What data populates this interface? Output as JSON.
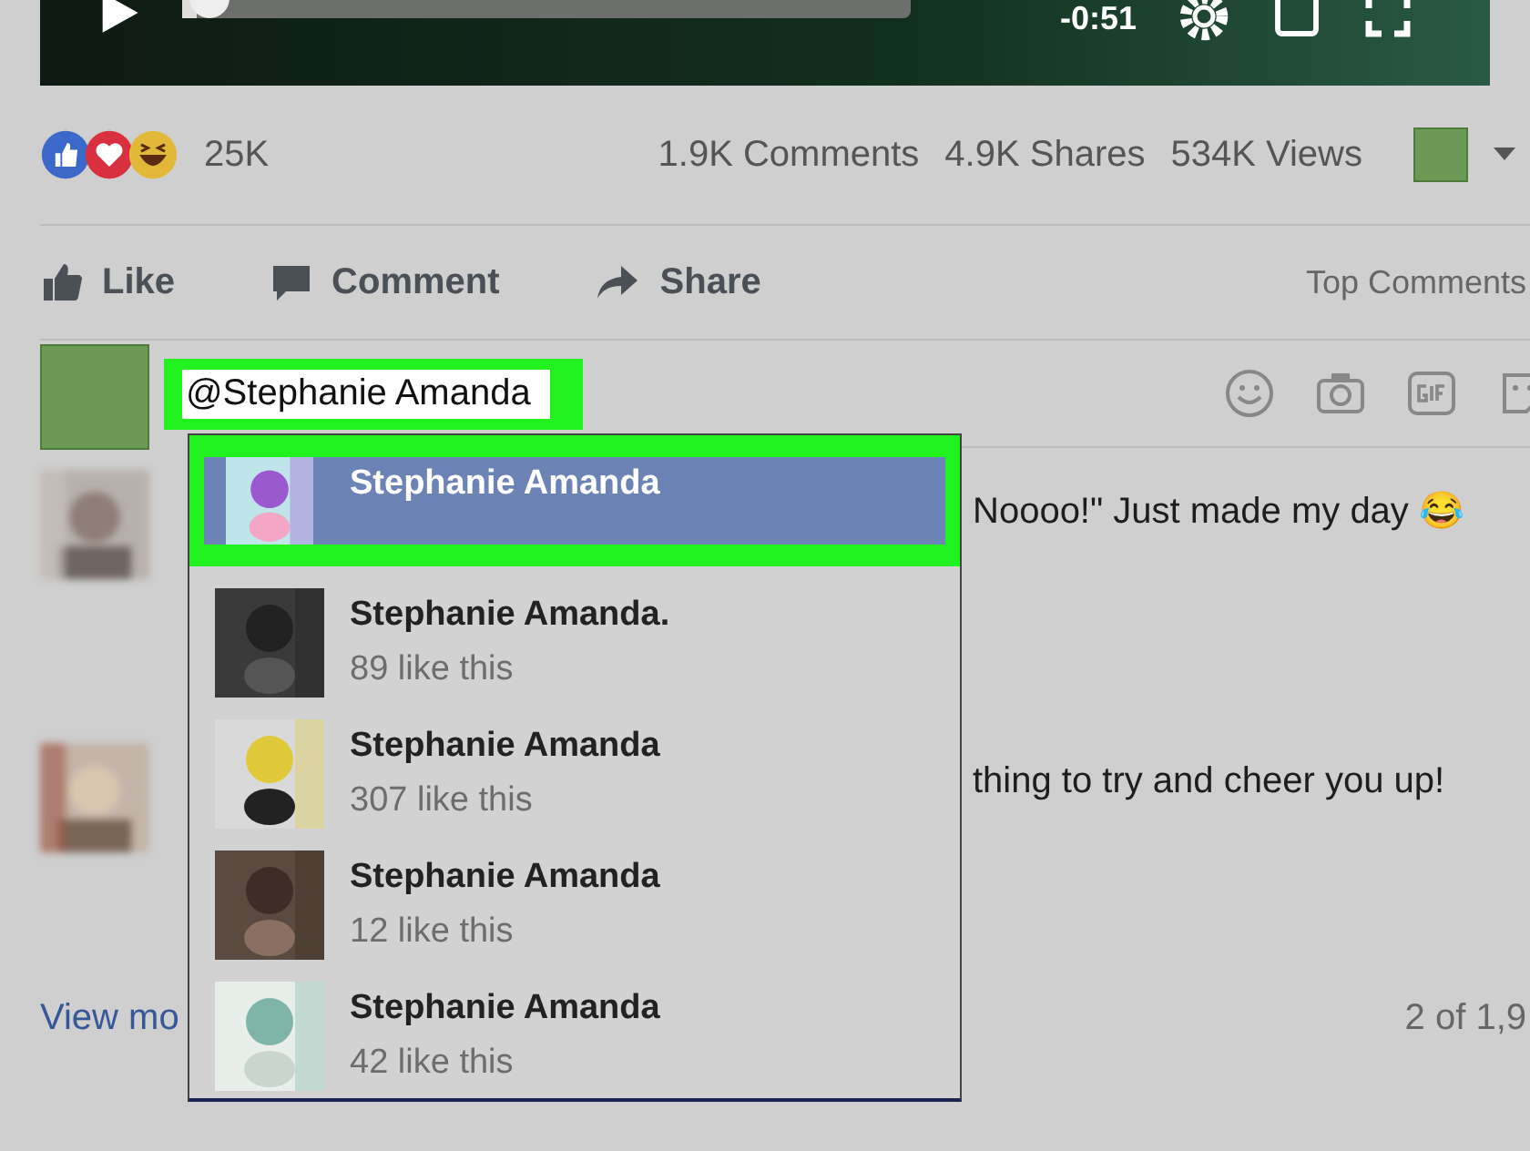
{
  "video": {
    "time": "-0:51",
    "progress": {
      "level": 0.02
    }
  },
  "stats": {
    "reactions_count": "25K",
    "comments": "1.9K Comments",
    "shares": "4.9K Shares",
    "views": "534K Views"
  },
  "actions": [
    {
      "kind": "like",
      "label": "Like"
    },
    {
      "kind": "comment",
      "label": "Comment"
    },
    {
      "kind": "share",
      "label": "Share"
    }
  ],
  "sort": "Top Comments",
  "composer": {
    "value": "@Stephanie Amanda",
    "highlighted": true
  },
  "comments": [
    {
      "text": "Noooo!\" Just made my day 😂"
    },
    {
      "text": "thing to try and cheer you up!"
    }
  ],
  "view_more": "View mo",
  "pager": "2 of 1,9",
  "suggestions": [
    {
      "name": "Stephanie Amanda",
      "selected": true
    },
    {
      "name": "Stephanie Amanda.",
      "likes": "89 like this",
      "selected": false
    },
    {
      "name": "Stephanie Amanda",
      "likes": "307 like this",
      "selected": false
    },
    {
      "name": "Stephanie Amanda",
      "likes": "12 like this",
      "selected": false
    },
    {
      "name": "Stephanie Amanda",
      "likes": "42 like this",
      "selected": false
    }
  ]
}
